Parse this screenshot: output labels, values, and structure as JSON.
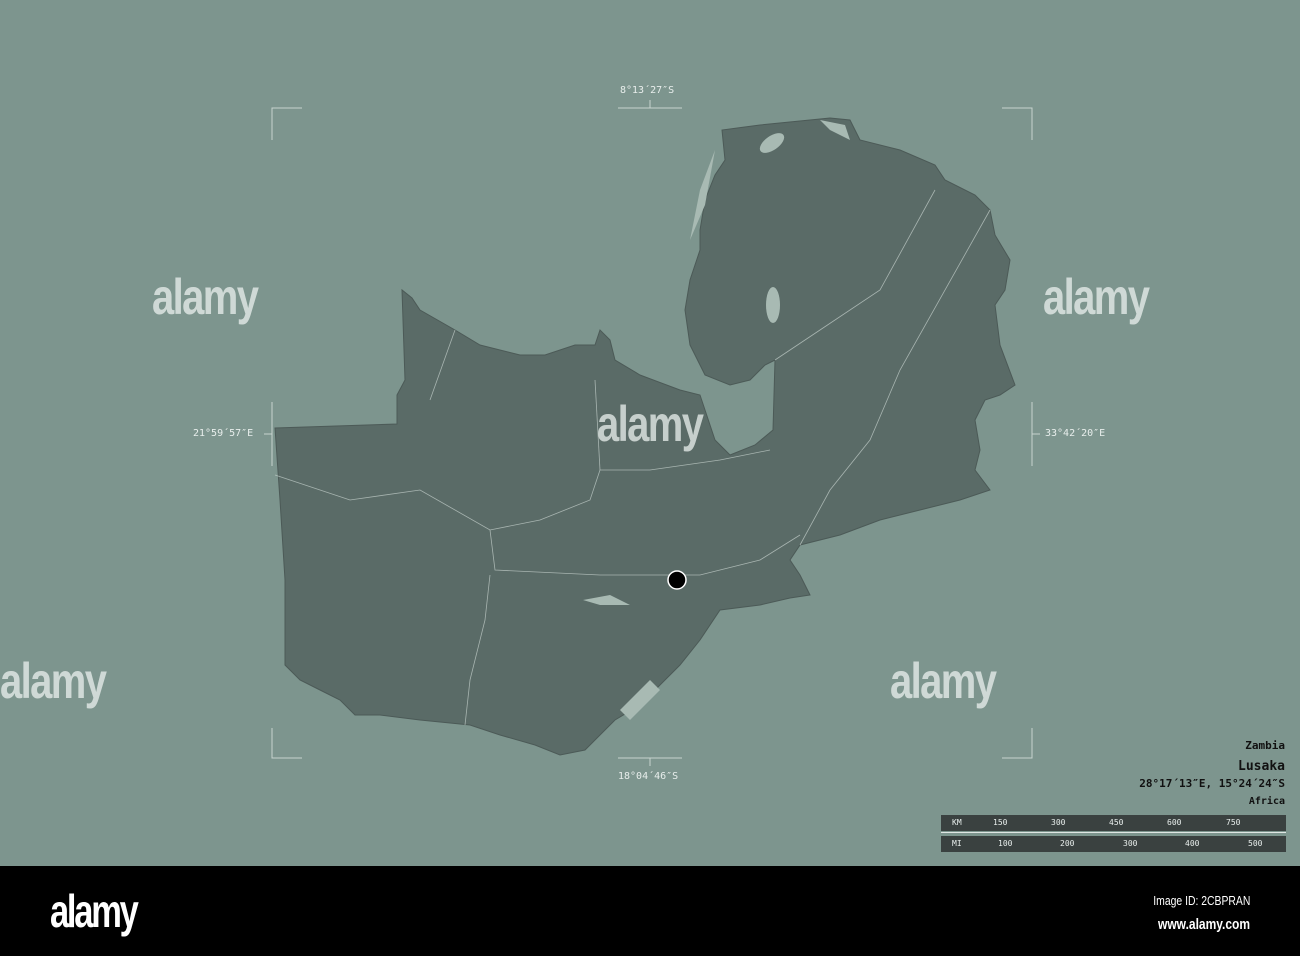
{
  "map": {
    "country": "Zambia",
    "capital": "Lusaka",
    "capital_coords": "28°17´13″E, 15°24´24″S",
    "continent": "Africa",
    "bounds": {
      "north": "8°13´27″S",
      "south": "18°04´46″S",
      "west": "21°59´57″E",
      "east": "33°42´20″E"
    },
    "colors": {
      "background": "#7d958e",
      "land": "#5a6b67",
      "water": "#a8bab3",
      "borders": "#c9d4d0"
    }
  },
  "scale_bar": {
    "km_label": "KM",
    "km_ticks": [
      "150",
      "300",
      "450",
      "600",
      "750"
    ],
    "mi_label": "MI",
    "mi_ticks": [
      "100",
      "200",
      "300",
      "400",
      "500"
    ]
  },
  "watermark": "alamy",
  "footer": {
    "logo": "alamy",
    "image_id": "Image ID: 2CBPRAN",
    "url": "www.alamy.com"
  }
}
